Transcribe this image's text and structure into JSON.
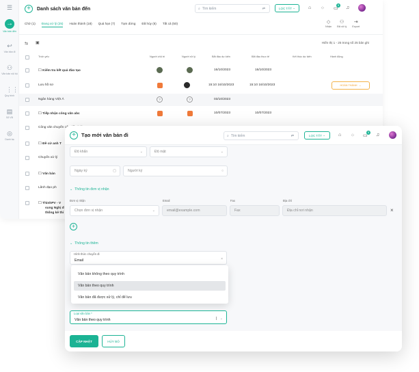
{
  "colors": {
    "accent": "#1bb394",
    "warning": "#f3a02a",
    "status_orange": "#f07a3a"
  },
  "sidebar": {
    "items": [
      {
        "label": "",
        "icon": "menu-icon"
      },
      {
        "label": "Văn bản đến",
        "icon": "arrow-in-icon"
      },
      {
        "label": "Văn bản đi",
        "icon": "arrow-out-icon"
      },
      {
        "label": "Văn bản nội bộ",
        "icon": "org-icon"
      },
      {
        "label": "Quy trình",
        "icon": "grid-icon"
      },
      {
        "label": "Sổ VB",
        "icon": "book-icon"
      },
      {
        "label": "Danh bạ",
        "icon": "location-icon"
      }
    ]
  },
  "bg": {
    "title": "Danh sách văn bản đến",
    "search_placeholder": "Tìm kiếm",
    "filter_label": "LỌC TẤT",
    "notif_count": "5",
    "tabs": [
      "Chờ (1)",
      "Đang xử lý (25)",
      "Hoàn thành (18)",
      "Quá hạn (7)",
      "Tạm dừng",
      "Đã hủy (6)",
      "Tất cả (50)"
    ],
    "tools": [
      "Nhận",
      "Đã xử lý",
      "Export"
    ],
    "showing": "Hiển thị 1 - 25 trong số 25 bản ghi",
    "columns": [
      "Trích yếu",
      "Người chủ trì",
      "Người xử lý",
      "Bắt đầu dự kiến",
      "Bắt đầu thực tế",
      "Kết thúc dự kiến",
      "Hành động"
    ],
    "rows": [
      {
        "title": "Kiểm tra kết quả đào tạo",
        "start_planned": "16/10/2023",
        "start_actual": "16/10/2023",
        "end_planned": "",
        "action": ""
      },
      {
        "title": "Lưu hồ sơ",
        "start_planned": "15:10 16/10/2023",
        "start_actual": "15:10 16/10/2023",
        "end_planned": "",
        "action": "HOÀN THÀNH"
      },
      {
        "title": "Ngân hàng Việt Á",
        "start_planned": "03/10/2023",
        "start_actual": "",
        "end_planned": "",
        "action": ""
      },
      {
        "title": "Tiếp nhận công văn abc",
        "start_planned": "10/07/2023",
        "start_actual": "10/07/2023",
        "end_planned": "",
        "action": ""
      },
      {
        "title": "Công văn chuyển cấp để xử lý",
        "start_planned": "",
        "start_actual": "",
        "end_planned": "",
        "action": ""
      },
      {
        "title": "Đề cử anh T",
        "start_planned": "",
        "start_actual": "",
        "end_planned": "",
        "action": ""
      },
      {
        "title": "Chuyển xử lý",
        "start_planned": "",
        "start_actual": "",
        "end_planned": "",
        "action": ""
      },
      {
        "title": "Văn bản",
        "start_planned": "",
        "start_actual": "",
        "end_planned": "",
        "action": ""
      },
      {
        "title": "Lãnh đạo ph",
        "start_planned": "",
        "start_actual": "",
        "end_planned": "",
        "action": ""
      },
      {
        "title": "ThinhPV - V",
        "line2": "sung Nghị đ",
        "line3": "thống kê thi",
        "start_planned": "",
        "start_actual": "",
        "end_planned": "",
        "action": ""
      }
    ]
  },
  "modal": {
    "title": "Tạo mới văn bản đi",
    "search_placeholder": "Tìm kiếm",
    "filter_label": "LỌC TẤT",
    "notif_count": "5",
    "do_khan_placeholder": "Độ khẩn",
    "do_mat_placeholder": "Độ mật",
    "ngay_ky_placeholder": "Ngày ký",
    "nguoi_ky_placeholder": "Người ký",
    "section_receiver": "Thông tin đơn vị nhận",
    "receiver_labels": {
      "unit": "Đơn vị nhận",
      "email": "Email",
      "fax": "Fax",
      "address": "Địa chỉ"
    },
    "receiver_placeholders": {
      "unit": "Chọn đơn vị nhận",
      "email": "email@example.com",
      "fax": "Fax",
      "address": "Địa chỉ nơi nhận"
    },
    "section_more": "Thông tin thêm",
    "transfer_label": "Hình thức chuyển đi",
    "transfer_value": "Email",
    "dropdown_options": [
      "Văn bản không theo quy trình",
      "Văn bản theo quy trình",
      "Văn bản đã được xử lý, chỉ để lưu"
    ],
    "doc_type_label": "Loại văn bản *",
    "doc_type_value": "Văn bản theo quy trình",
    "update_button": "CẬP NHẬT",
    "cancel_button": "HỦY BỎ"
  }
}
